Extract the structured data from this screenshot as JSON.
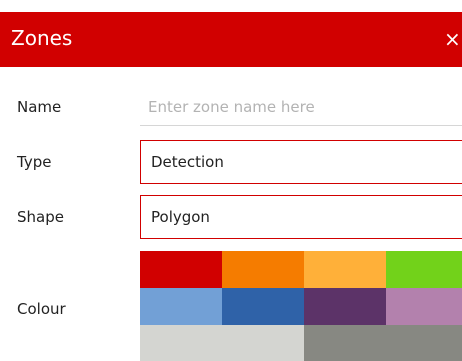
{
  "dialog": {
    "title": "Zones",
    "close_label": "×"
  },
  "form": {
    "name": {
      "label": "Name",
      "placeholder": "Enter zone name here",
      "value": ""
    },
    "type": {
      "label": "Type",
      "value": "Detection"
    },
    "shape": {
      "label": "Shape",
      "value": "Polygon"
    },
    "colour": {
      "label": "Colour",
      "swatches": [
        {
          "name": "red",
          "color": "#d10000"
        },
        {
          "name": "orange",
          "color": "#f57c00"
        },
        {
          "name": "amber",
          "color": "#ffb039"
        },
        {
          "name": "green",
          "color": "#72d21a"
        },
        {
          "name": "light-blue",
          "color": "#72a0d6"
        },
        {
          "name": "blue",
          "color": "#2f62a8"
        },
        {
          "name": "purple",
          "color": "#5c3368"
        },
        {
          "name": "mauve",
          "color": "#b381ad"
        },
        {
          "name": "light-grey",
          "color": "#d4d5d1"
        },
        {
          "name": "dark-grey",
          "color": "#878882"
        }
      ]
    }
  }
}
